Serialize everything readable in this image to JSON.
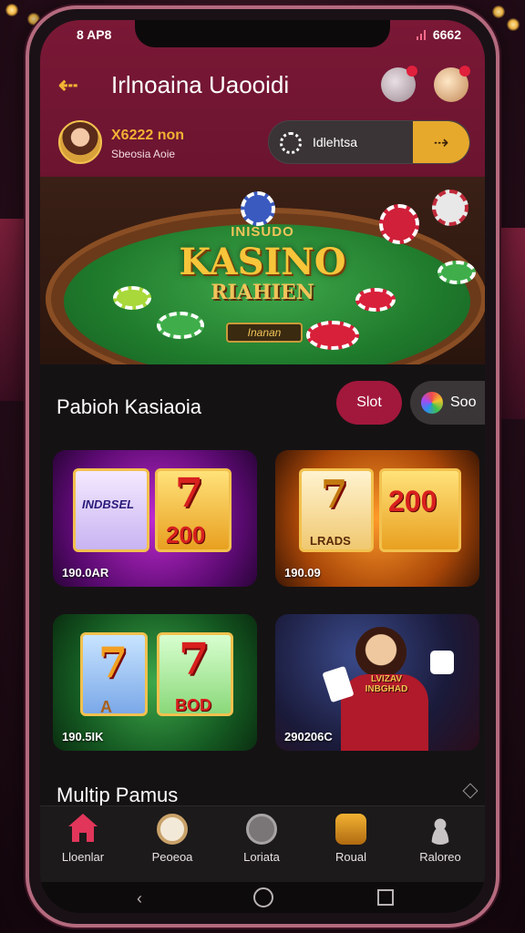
{
  "status": {
    "left": "8 AP8",
    "right": "6662"
  },
  "header": {
    "title": "Irlnoaina Uaooidi",
    "back_icon": "arrow-left-icon"
  },
  "user": {
    "balance": "X6222 non",
    "subtitle": "Sbeosia Aoie"
  },
  "wallet": {
    "label": "Idlehtsa"
  },
  "hero": {
    "line1": "INISUDO",
    "line2": "KASINO",
    "line3": "RIAHIEN",
    "plaque": "Inanan"
  },
  "section": {
    "title": "Pabioh Kasiaoia",
    "tab_active": "Slot",
    "tab_other": "Soo"
  },
  "games": [
    {
      "caption": "190.0AR",
      "reel_a": "INDBSEL",
      "reel_b": "200"
    },
    {
      "caption": "190.09",
      "reel_a": "LRADS",
      "reel_b": "200"
    },
    {
      "caption": "190.5IK",
      "reel_a": "A",
      "reel_b": "BOD"
    },
    {
      "caption": "290206C",
      "banner": "LVIZAV INBGHAD"
    }
  ],
  "subsection": {
    "title": "Multip Pamus"
  },
  "nav": [
    {
      "label": "Lloenlar",
      "icon": "home-icon"
    },
    {
      "label": "Peoeoa",
      "icon": "chip-icon"
    },
    {
      "label": "Loriata",
      "icon": "gamepad-icon"
    },
    {
      "label": "Roual",
      "icon": "trophy-icon"
    },
    {
      "label": "Raloreo",
      "icon": "user-icon"
    }
  ],
  "colors": {
    "header": "#7a1836",
    "accent": "#f2b233",
    "active_tab": "#a2183c"
  }
}
